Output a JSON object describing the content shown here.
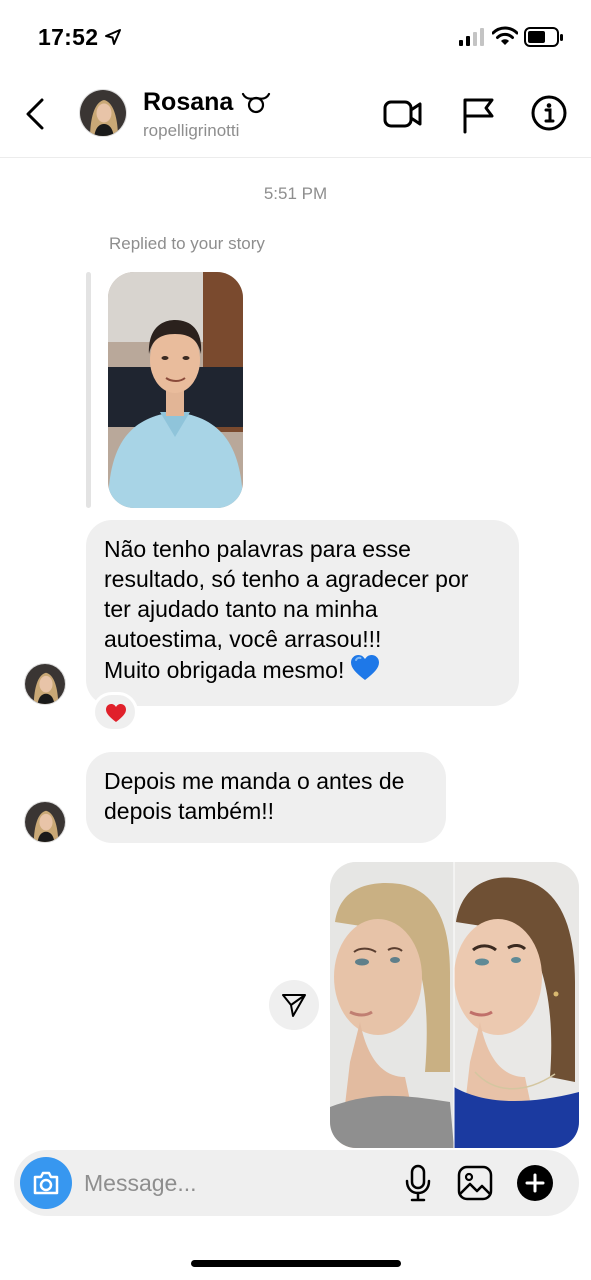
{
  "status_bar": {
    "time": "17:52",
    "location_icon": "location-arrow-icon",
    "signal_icon": "cellular-signal-icon",
    "wifi_icon": "wifi-icon",
    "battery_icon": "battery-icon"
  },
  "header": {
    "name": "Rosana",
    "username": "ropelligrinotti",
    "back_icon": "chevron-left-icon",
    "video_icon": "video-call-icon",
    "flag_icon": "flag-icon",
    "info_icon": "info-icon"
  },
  "conversation": {
    "timestamp": "5:51 PM",
    "story_reply_note": "Replied to your story",
    "messages": [
      {
        "sender": "Rosana",
        "lines": [
          "Não tenho palavras para esse",
          "resultado, só tenho a agradecer por",
          "ter ajudado tanto na minha",
          "autoestima, você arrasou!!!",
          "Muito obrigada mesmo!"
        ],
        "emoji": "blue-heart-icon",
        "reaction": "red-heart-icon"
      },
      {
        "sender": "Rosana",
        "lines": [
          "Depois me manda o antes de",
          "depois também!!"
        ]
      }
    ],
    "sent_image_icon": "before-after-photo",
    "share_icon": "send-icon"
  },
  "composer": {
    "placeholder": "Message...",
    "camera_icon": "camera-icon",
    "mic_icon": "microphone-icon",
    "gallery_icon": "gallery-icon",
    "plus_icon": "plus-circle-icon"
  },
  "colors": {
    "accent": "#3797f0",
    "bubble": "#efefef",
    "secondary_text": "#8e8e8e",
    "heart_red": "#e0202a",
    "heart_blue": "#1e78e8"
  }
}
